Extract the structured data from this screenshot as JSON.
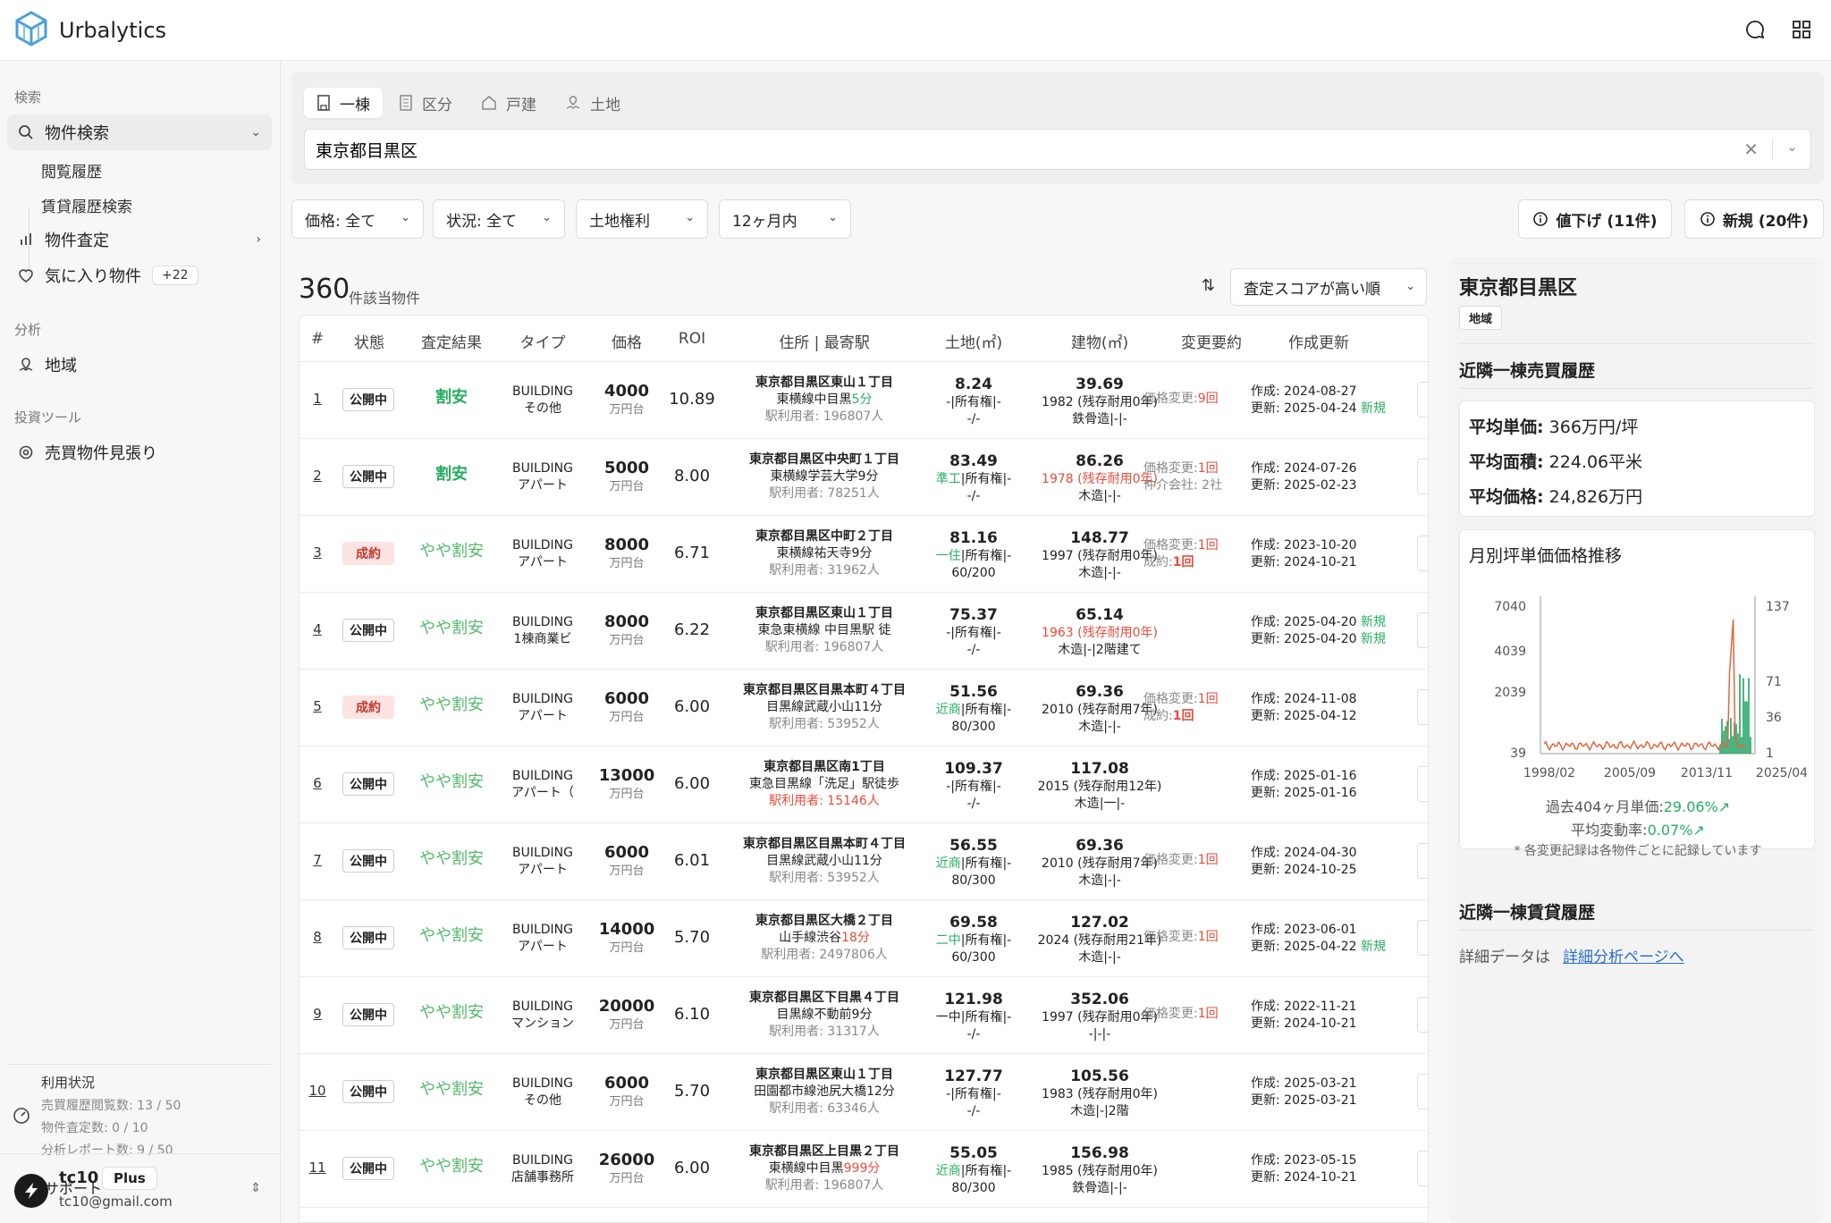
{
  "app": {
    "name": "Urbalytics"
  },
  "sidebar": {
    "sections": {
      "search": "検索",
      "analysis": "分析",
      "tools": "投資ツール"
    },
    "items": {
      "property_search": "物件検索",
      "history": "閲覧履歴",
      "rent_history": "賃貸履歴検索",
      "valuation": "物件査定",
      "favorites": "気に入り物件",
      "favorites_count": "+22",
      "region": "地域",
      "watch": "売買物件見張り"
    },
    "usage": {
      "title": "利用状況",
      "line1": "売買履歴閲覧数: 13 / 50",
      "line2": "物件査定数: 0 / 10",
      "line3": "分析レポート数: 9 / 50"
    },
    "support": "サポート",
    "user": {
      "name": "tc10",
      "plan": "Plus",
      "email": "tc10@gmail.com"
    }
  },
  "search": {
    "tabs": [
      "一棟",
      "区分",
      "戸建",
      "土地"
    ],
    "active_tab": 0,
    "query": "東京都目黒区"
  },
  "filters": {
    "price": "価格: 全て",
    "status": "状況: 全て",
    "land_rights": "土地権利",
    "period": "12ヶ月内",
    "price_down": "値下げ (11件)",
    "new": "新規 (20件)"
  },
  "results": {
    "count": "360",
    "count_label": "件該当物件",
    "sort": "査定スコアが高い順",
    "columns": [
      "#",
      "状態",
      "査定結果",
      "タイプ",
      "価格",
      "ROI",
      "住所 | 最寄駅",
      "土地(㎡)",
      "建物(㎡)",
      "変更要約",
      "作成更新"
    ],
    "rows": [
      {
        "num": "1",
        "status": "公開中",
        "status_kind": "open",
        "result": "割安",
        "result_kind": "good",
        "type1": "BUILDING",
        "type2": "その他",
        "price": "4000",
        "unit": "万円台",
        "roi": "10.89",
        "addr1": "東京都目黒区東山１丁目",
        "station": "東横線中目黒",
        "walk": "5分",
        "walk_kind": "green",
        "users": "駅利用者: 196807人",
        "users_kind": "gray",
        "land": "8.24",
        "zone": "",
        "land2": "-|所有権|-",
        "land3": "-/-",
        "bldg": "39.69",
        "bldg2": "1982 (残存耐用0年)",
        "bldg2_kind": "normal",
        "bldg3": "鉄骨造|-|-",
        "chg1": "価格変更:",
        "chg1v": "9回",
        "chg2": "",
        "chg2v": "",
        "created": "作成:  2024-08-27",
        "created_new": "",
        "updated": "更新:  2025-04-24",
        "updated_new": "新規"
      },
      {
        "num": "2",
        "status": "公開中",
        "status_kind": "open",
        "result": "割安",
        "result_kind": "good",
        "type1": "BUILDING",
        "type2": "アパート",
        "price": "5000",
        "unit": "万円台",
        "roi": "8.00",
        "addr1": "東京都目黒区中央町１丁目",
        "station": "東横線学芸大学9分",
        "walk": "",
        "walk_kind": "",
        "users": "駅利用者: 78251人",
        "users_kind": "gray",
        "land": "83.49",
        "zone": "準工",
        "land2": "|所有権|-",
        "land3": "-/-",
        "bldg": "86.26",
        "bldg2": "1978 (残存耐用0年)",
        "bldg2_kind": "red",
        "bldg3": "木造|-|-",
        "chg1": "価格変更:",
        "chg1v": "1回",
        "chg2": "仲介会社: 2社",
        "chg2v": "",
        "created": "作成:  2024-07-26",
        "created_new": "",
        "updated": "更新:  2025-02-23",
        "updated_new": ""
      },
      {
        "num": "3",
        "status": "成約",
        "status_kind": "sold",
        "result": "やや割安",
        "result_kind": "ok",
        "type1": "BUILDING",
        "type2": "アパート",
        "price": "8000",
        "unit": "万円台",
        "roi": "6.71",
        "addr1": "東京都目黒区中町２丁目",
        "station": "東横線祐天寺9分",
        "walk": "",
        "walk_kind": "",
        "users": "駅利用者: 31962人",
        "users_kind": "gray",
        "land": "81.16",
        "zone": "一住",
        "land2": "|所有権|-",
        "land3": "60/200",
        "bldg": "148.77",
        "bldg2": "1997 (残存耐用0年)",
        "bldg2_kind": "normal",
        "bldg3": "木造|-|-",
        "chg1": "価格変更:",
        "chg1v": "1回",
        "chg2": "成約:",
        "chg2v": "1回",
        "created": "作成:  2023-10-20",
        "created_new": "",
        "updated": "更新:  2024-10-21",
        "updated_new": ""
      },
      {
        "num": "4",
        "status": "公開中",
        "status_kind": "open",
        "result": "やや割安",
        "result_kind": "ok",
        "type1": "BUILDING",
        "type2": "1棟商業ビ",
        "price": "8000",
        "unit": "万円台",
        "roi": "6.22",
        "addr1": "東京都目黒区東山１丁目",
        "station": "東急東横線 中目黒駅 徒",
        "walk": "",
        "walk_kind": "",
        "users": "駅利用者: 196807人",
        "users_kind": "gray",
        "land": "75.37",
        "zone": "",
        "land2": "-|所有権|-",
        "land3": "-/-",
        "bldg": "65.14",
        "bldg2": "1963 (残存耐用0年)",
        "bldg2_kind": "red",
        "bldg3": "木造|-|2階建て",
        "chg1": "",
        "chg1v": "",
        "chg2": "",
        "chg2v": "",
        "created": "作成:  2025-04-20",
        "created_new": "新規",
        "updated": "更新:  2025-04-20",
        "updated_new": "新規"
      },
      {
        "num": "5",
        "status": "成約",
        "status_kind": "sold",
        "result": "やや割安",
        "result_kind": "ok",
        "type1": "BUILDING",
        "type2": "アパート",
        "price": "6000",
        "unit": "万円台",
        "roi": "6.00",
        "addr1": "東京都目黒区目黒本町４丁目",
        "station": "目黒線武蔵小山11分",
        "walk": "",
        "walk_kind": "",
        "users": "駅利用者: 53952人",
        "users_kind": "gray",
        "land": "51.56",
        "zone": "近商",
        "land2": "|所有権|-",
        "land3": "80/300",
        "bldg": "69.36",
        "bldg2": "2010 (残存耐用7年)",
        "bldg2_kind": "normal",
        "bldg3": "木造|-|-",
        "chg1": "価格変更:",
        "chg1v": "1回",
        "chg2": "成約:",
        "chg2v": "1回",
        "created": "作成:  2024-11-08",
        "created_new": "",
        "updated": "更新:  2025-04-12",
        "updated_new": ""
      },
      {
        "num": "6",
        "status": "公開中",
        "status_kind": "open",
        "result": "やや割安",
        "result_kind": "ok",
        "type1": "BUILDING",
        "type2": "アパート（",
        "price": "13000",
        "unit": "万円台",
        "roi": "6.00",
        "addr1": "東京都目黒区南1丁目",
        "station": "東急目黒線「洗足」駅徒歩",
        "walk": "",
        "walk_kind": "",
        "users": "駅利用者: 15146人",
        "users_kind": "red",
        "land": "109.37",
        "zone": "",
        "land2": "-|所有権|-",
        "land3": "-/-",
        "bldg": "117.08",
        "bldg2": "2015 (残存耐用12年)",
        "bldg2_kind": "normal",
        "bldg3": "木造|一|-",
        "chg1": "",
        "chg1v": "",
        "chg2": "",
        "chg2v": "",
        "created": "作成:  2025-01-16",
        "created_new": "",
        "updated": "更新:  2025-01-16",
        "updated_new": ""
      },
      {
        "num": "7",
        "status": "公開中",
        "status_kind": "open",
        "result": "やや割安",
        "result_kind": "ok",
        "type1": "BUILDING",
        "type2": "アパート",
        "price": "6000",
        "unit": "万円台",
        "roi": "6.01",
        "addr1": "東京都目黒区目黒本町４丁目",
        "station": "目黒線武蔵小山11分",
        "walk": "",
        "walk_kind": "",
        "users": "駅利用者: 53952人",
        "users_kind": "gray",
        "land": "56.55",
        "zone": "近商",
        "land2": "|所有権|-",
        "land3": "80/300",
        "bldg": "69.36",
        "bldg2": "2010 (残存耐用7年)",
        "bldg2_kind": "normal",
        "bldg3": "木造|-|-",
        "chg1": "価格変更:",
        "chg1v": "1回",
        "chg2": "",
        "chg2v": "",
        "created": "作成:  2024-04-30",
        "created_new": "",
        "updated": "更新:  2024-10-25",
        "updated_new": ""
      },
      {
        "num": "8",
        "status": "公開中",
        "status_kind": "open",
        "result": "やや割安",
        "result_kind": "ok",
        "type1": "BUILDING",
        "type2": "アパート",
        "price": "14000",
        "unit": "万円台",
        "roi": "5.70",
        "addr1": "東京都目黒区大橋２丁目",
        "station": "山手線渋谷",
        "walk": "18分",
        "walk_kind": "red",
        "users": "駅利用者: 2497806人",
        "users_kind": "gray",
        "land": "69.58",
        "zone": "二中",
        "land2": "|所有権|-",
        "land3": "60/300",
        "bldg": "127.02",
        "bldg2": "2024 (残存耐用21年)",
        "bldg2_kind": "normal",
        "bldg3": "木造|-|-",
        "chg1": "価格変更:",
        "chg1v": "1回",
        "chg2": "",
        "chg2v": "",
        "created": "作成:  2023-06-01",
        "created_new": "",
        "updated": "更新:  2025-04-22",
        "updated_new": "新規"
      },
      {
        "num": "9",
        "status": "公開中",
        "status_kind": "open",
        "result": "やや割安",
        "result_kind": "ok",
        "type1": "BUILDING",
        "type2": "マンション",
        "price": "20000",
        "unit": "万円台",
        "roi": "6.10",
        "addr1": "東京都目黒区下目黒４丁目",
        "station": "目黒線不動前9分",
        "walk": "",
        "walk_kind": "",
        "users": "駅利用者: 31317人",
        "users_kind": "gray",
        "land": "121.98",
        "zone": "",
        "land2": "一中|所有権|-",
        "land3": "-/-",
        "bldg": "352.06",
        "bldg2": "1997 (残存耐用0年)",
        "bldg2_kind": "normal",
        "bldg3": "-|-|-",
        "chg1": "価格変更:",
        "chg1v": "1回",
        "chg2": "",
        "chg2v": "",
        "created": "作成:  2022-11-21",
        "created_new": "",
        "updated": "更新:  2024-10-21",
        "updated_new": ""
      },
      {
        "num": "10",
        "status": "公開中",
        "status_kind": "open",
        "result": "やや割安",
        "result_kind": "ok",
        "type1": "BUILDING",
        "type2": "その他",
        "price": "6000",
        "unit": "万円台",
        "roi": "5.70",
        "addr1": "東京都目黒区東山１丁目",
        "station": "田園都市線池尻大橋12分",
        "walk": "",
        "walk_kind": "",
        "users": "駅利用者: 63346人",
        "users_kind": "gray",
        "land": "127.77",
        "zone": "",
        "land2": "-|所有権|-",
        "land3": "-/-",
        "bldg": "105.56",
        "bldg2": "1983 (残存耐用0年)",
        "bldg2_kind": "normal",
        "bldg3": "木造|-|2階",
        "chg1": "",
        "chg1v": "",
        "chg2": "",
        "chg2v": "",
        "created": "作成:  2025-03-21",
        "created_new": "",
        "updated": "更新:  2025-03-21",
        "updated_new": ""
      },
      {
        "num": "11",
        "status": "公開中",
        "status_kind": "open",
        "result": "やや割安",
        "result_kind": "ok",
        "type1": "BUILDING",
        "type2": "店舗事務所",
        "price": "26000",
        "unit": "万円台",
        "roi": "6.00",
        "addr1": "東京都目黒区上目黒２丁目",
        "station": "東横線中目黒",
        "walk": "999分",
        "walk_kind": "red",
        "users": "駅利用者: 196807人",
        "users_kind": "gray",
        "land": "55.05",
        "zone": "近商",
        "land2": "|所有権|-",
        "land3": "80/300",
        "bldg": "156.98",
        "bldg2": "1985 (残存耐用0年)",
        "bldg2_kind": "normal",
        "bldg3": "鉄骨造|-|-",
        "chg1": "",
        "chg1v": "",
        "chg2": "",
        "chg2v": "",
        "created": "作成:  2023-05-15",
        "created_new": "",
        "updated": "更新:  2024-10-21",
        "updated_new": ""
      }
    ]
  },
  "panel": {
    "title": "東京都目黒区",
    "tag": "地域",
    "sales_title": "近隣一棟売買履歴",
    "avg_unit_label": "平均単価:",
    "avg_unit": " 366万円/坪",
    "avg_area_label": "平均面積:",
    "avg_area": " 224.06平米",
    "avg_price_label": "平均価格:",
    "avg_price": " 24,826万円",
    "trend_title": "月別坪単価価格推移",
    "note1_prefix": "過去404ヶ月単価:",
    "note1_value": "29.06%",
    "note2_prefix": "平均変動率:",
    "note2_value": "0.07%",
    "note3": "* 各変更記録は各物件ごとに記録しています",
    "rent_title": "近隣一棟賃貸履歴",
    "detail_label": "詳細データは",
    "detail_link": "詳細分析ページへ"
  },
  "chart_data": {
    "type": "line",
    "title": "月別坪単価価格推移",
    "x_ticks": [
      "1998/02",
      "2005/09",
      "2013/11",
      "2025/04"
    ],
    "y_left_ticks": [
      "39",
      "2039",
      "4039",
      "7040"
    ],
    "y_right_ticks": [
      "1",
      "36",
      "71",
      "137"
    ],
    "ylim_left": [
      39,
      7040
    ],
    "ylim_right": [
      1,
      137
    ],
    "series": [],
    "colors": {
      "line": "#e2663a",
      "bars": "#2aa86b"
    }
  }
}
